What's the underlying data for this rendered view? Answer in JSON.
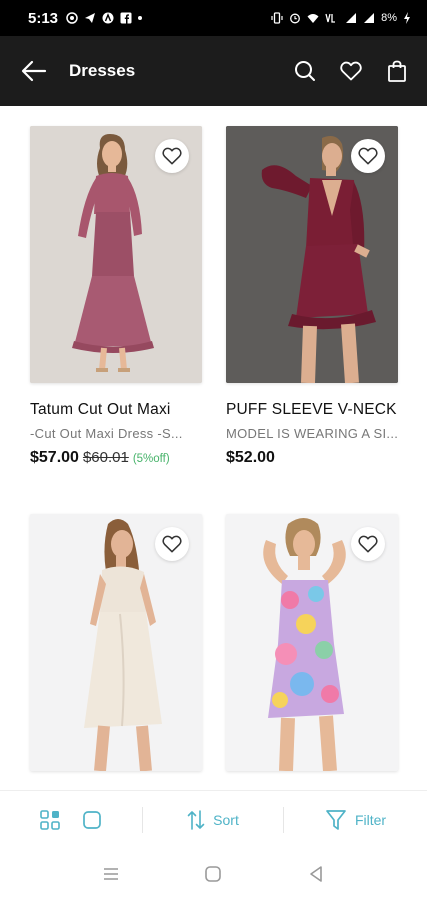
{
  "status_bar": {
    "time": "5:13",
    "battery": "8%"
  },
  "app_bar": {
    "title": "Dresses"
  },
  "products": [
    {
      "name": "Tatum Cut Out Maxi",
      "description": "-Cut Out Maxi Dress -S...",
      "price": "$57.00",
      "old_price": "$60.01",
      "discount": "(5%off)"
    },
    {
      "name": "PUFF SLEEVE V-NECK",
      "description": "MODEL IS WEARING A SI...",
      "price": "$52.00",
      "old_price": "",
      "discount": ""
    },
    {
      "name": "",
      "description": "",
      "price": "",
      "old_price": "",
      "discount": ""
    },
    {
      "name": "",
      "description": "",
      "price": "",
      "old_price": "",
      "discount": ""
    }
  ],
  "action_bar": {
    "sort_label": "Sort",
    "filter_label": "Filter"
  },
  "colors": {
    "accent": "#4fb3c7",
    "discount_green": "#47b36a",
    "app_bar_bg": "#1c1c1c"
  }
}
